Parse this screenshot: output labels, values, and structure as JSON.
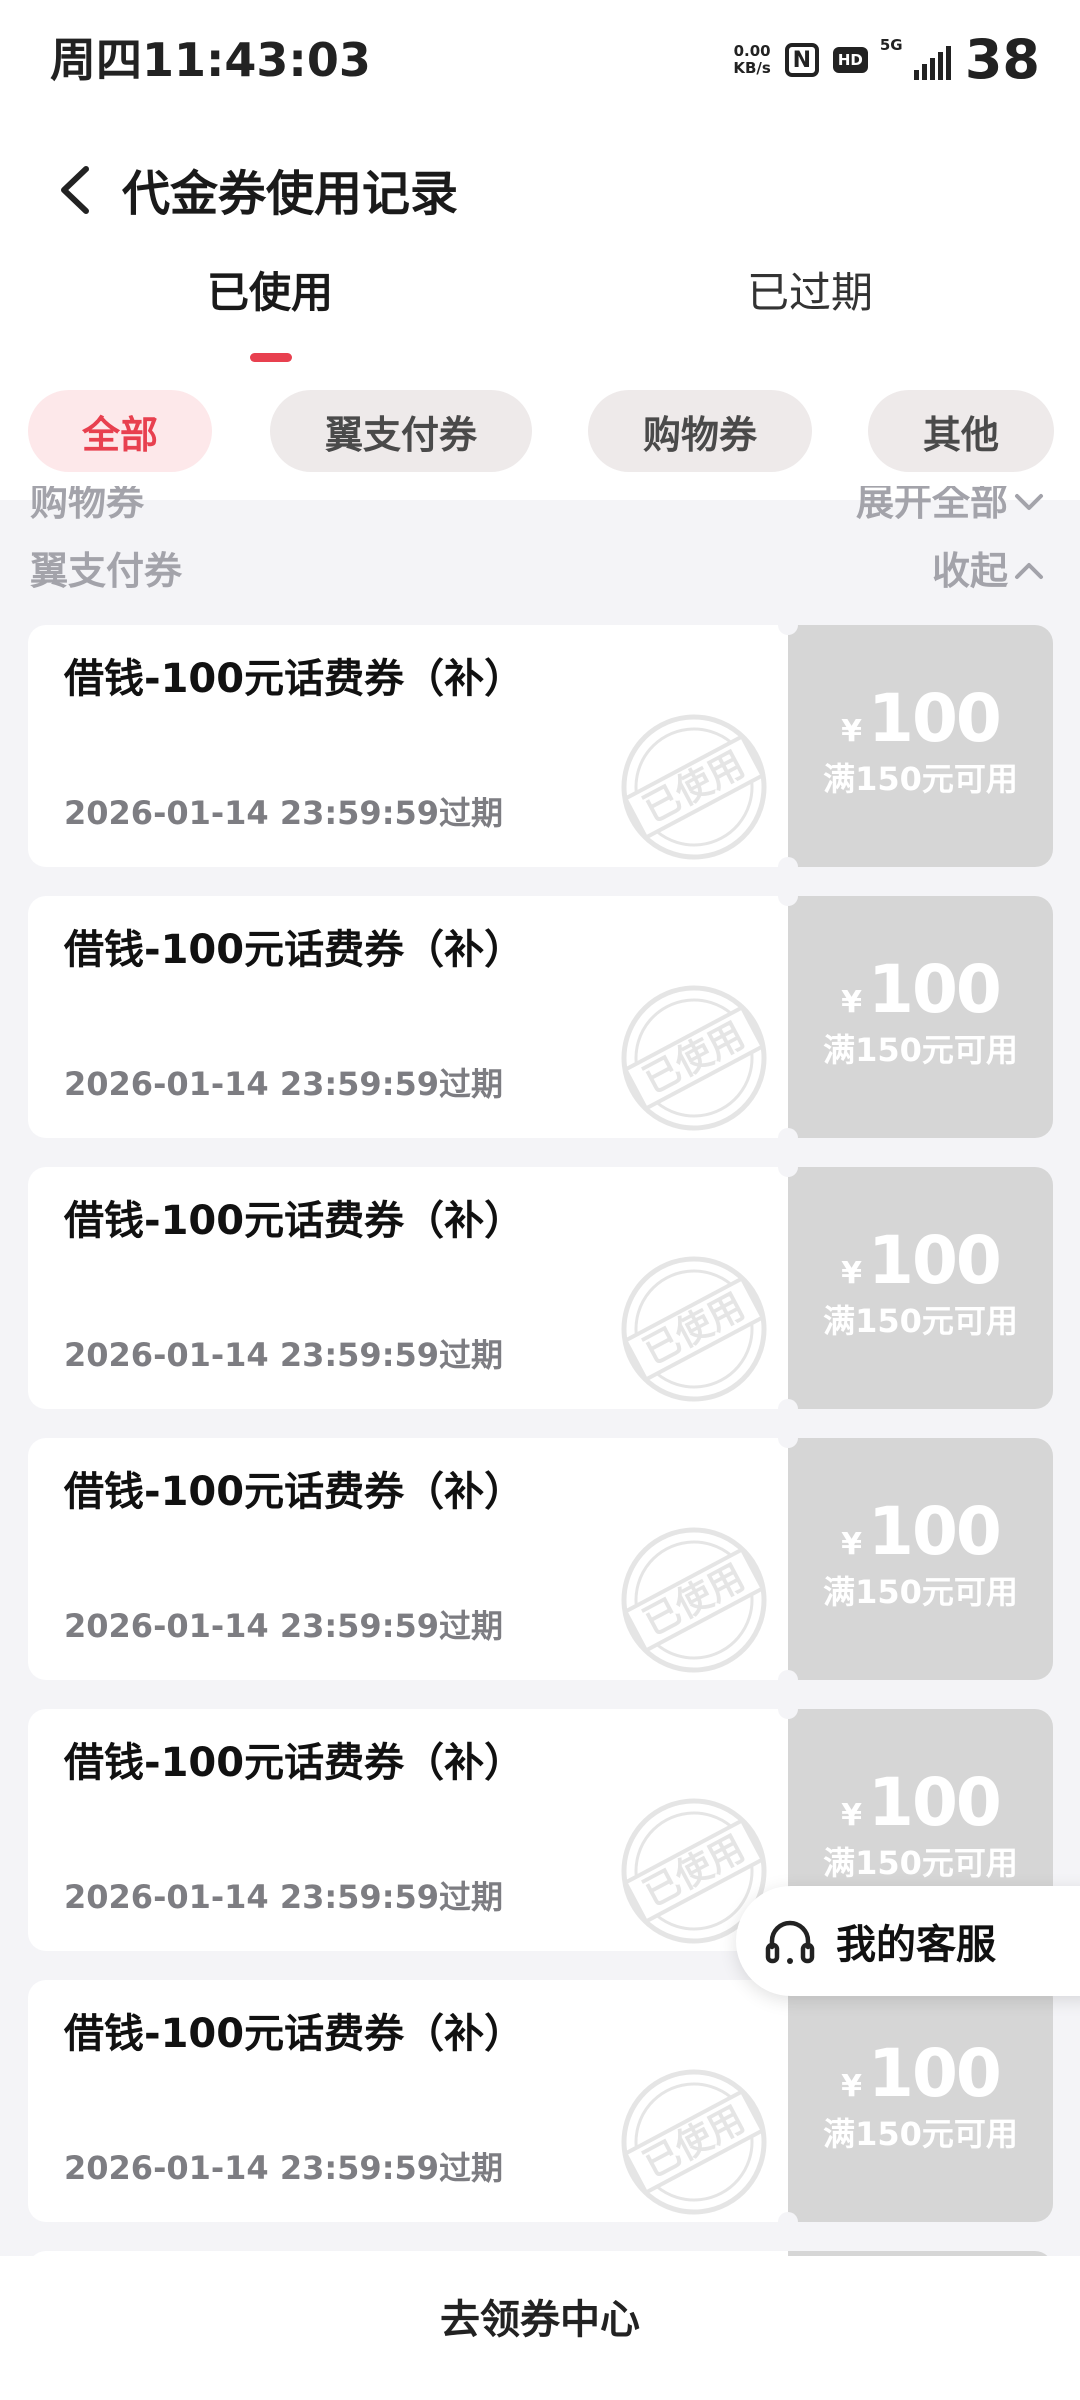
{
  "status_bar": {
    "time": "周四11:43:03",
    "net_speed_value": "0.00",
    "net_speed_unit": "KB/s",
    "nfc": "N",
    "hd": "HD",
    "network": "5G",
    "battery": "38",
    "icons": [
      "nfc-icon",
      "hd-icon",
      "signal-icon"
    ]
  },
  "nav": {
    "title": "代金券使用记录",
    "back_icon": "chevron-left-icon"
  },
  "tabs": [
    {
      "label": "已使用",
      "active": true
    },
    {
      "label": "已过期",
      "active": false
    }
  ],
  "accent_color": "#e8404f",
  "filters": [
    {
      "label": "全部",
      "active": true
    },
    {
      "label": "翼支付券",
      "active": false
    },
    {
      "label": "购物券",
      "active": false
    },
    {
      "label": "其他",
      "active": false
    }
  ],
  "groups": [
    {
      "label": "购物券",
      "action": "展开全部",
      "icon": "chevron-down-icon"
    },
    {
      "label": "翼支付券",
      "action": "收起",
      "icon": "chevron-up-icon"
    }
  ],
  "coupons": [
    {
      "title": "借钱-100元话费券（补）",
      "expiry": "2026-01-14 23:59:59过期",
      "currency": "¥",
      "amount": "100",
      "condition": "满150元可用",
      "stamp": "已使用"
    },
    {
      "title": "借钱-100元话费券（补）",
      "expiry": "2026-01-14 23:59:59过期",
      "currency": "¥",
      "amount": "100",
      "condition": "满150元可用",
      "stamp": "已使用"
    },
    {
      "title": "借钱-100元话费券（补）",
      "expiry": "2026-01-14 23:59:59过期",
      "currency": "¥",
      "amount": "100",
      "condition": "满150元可用",
      "stamp": "已使用"
    },
    {
      "title": "借钱-100元话费券（补）",
      "expiry": "2026-01-14 23:59:59过期",
      "currency": "¥",
      "amount": "100",
      "condition": "满150元可用",
      "stamp": "已使用"
    },
    {
      "title": "借钱-100元话费券（补）",
      "expiry": "2026-01-14 23:59:59过期",
      "currency": "¥",
      "amount": "100",
      "condition": "满150元可用",
      "stamp": "已使用"
    },
    {
      "title": "借钱-100元话费券（补）",
      "expiry": "2026-01-14 23:59:59过期",
      "currency": "¥",
      "amount": "100",
      "condition": "满150元可用",
      "stamp": "已使用"
    }
  ],
  "customer_service": {
    "label": "我的客服",
    "icon": "headset-icon"
  },
  "bottom": {
    "label": "去领券中心"
  }
}
